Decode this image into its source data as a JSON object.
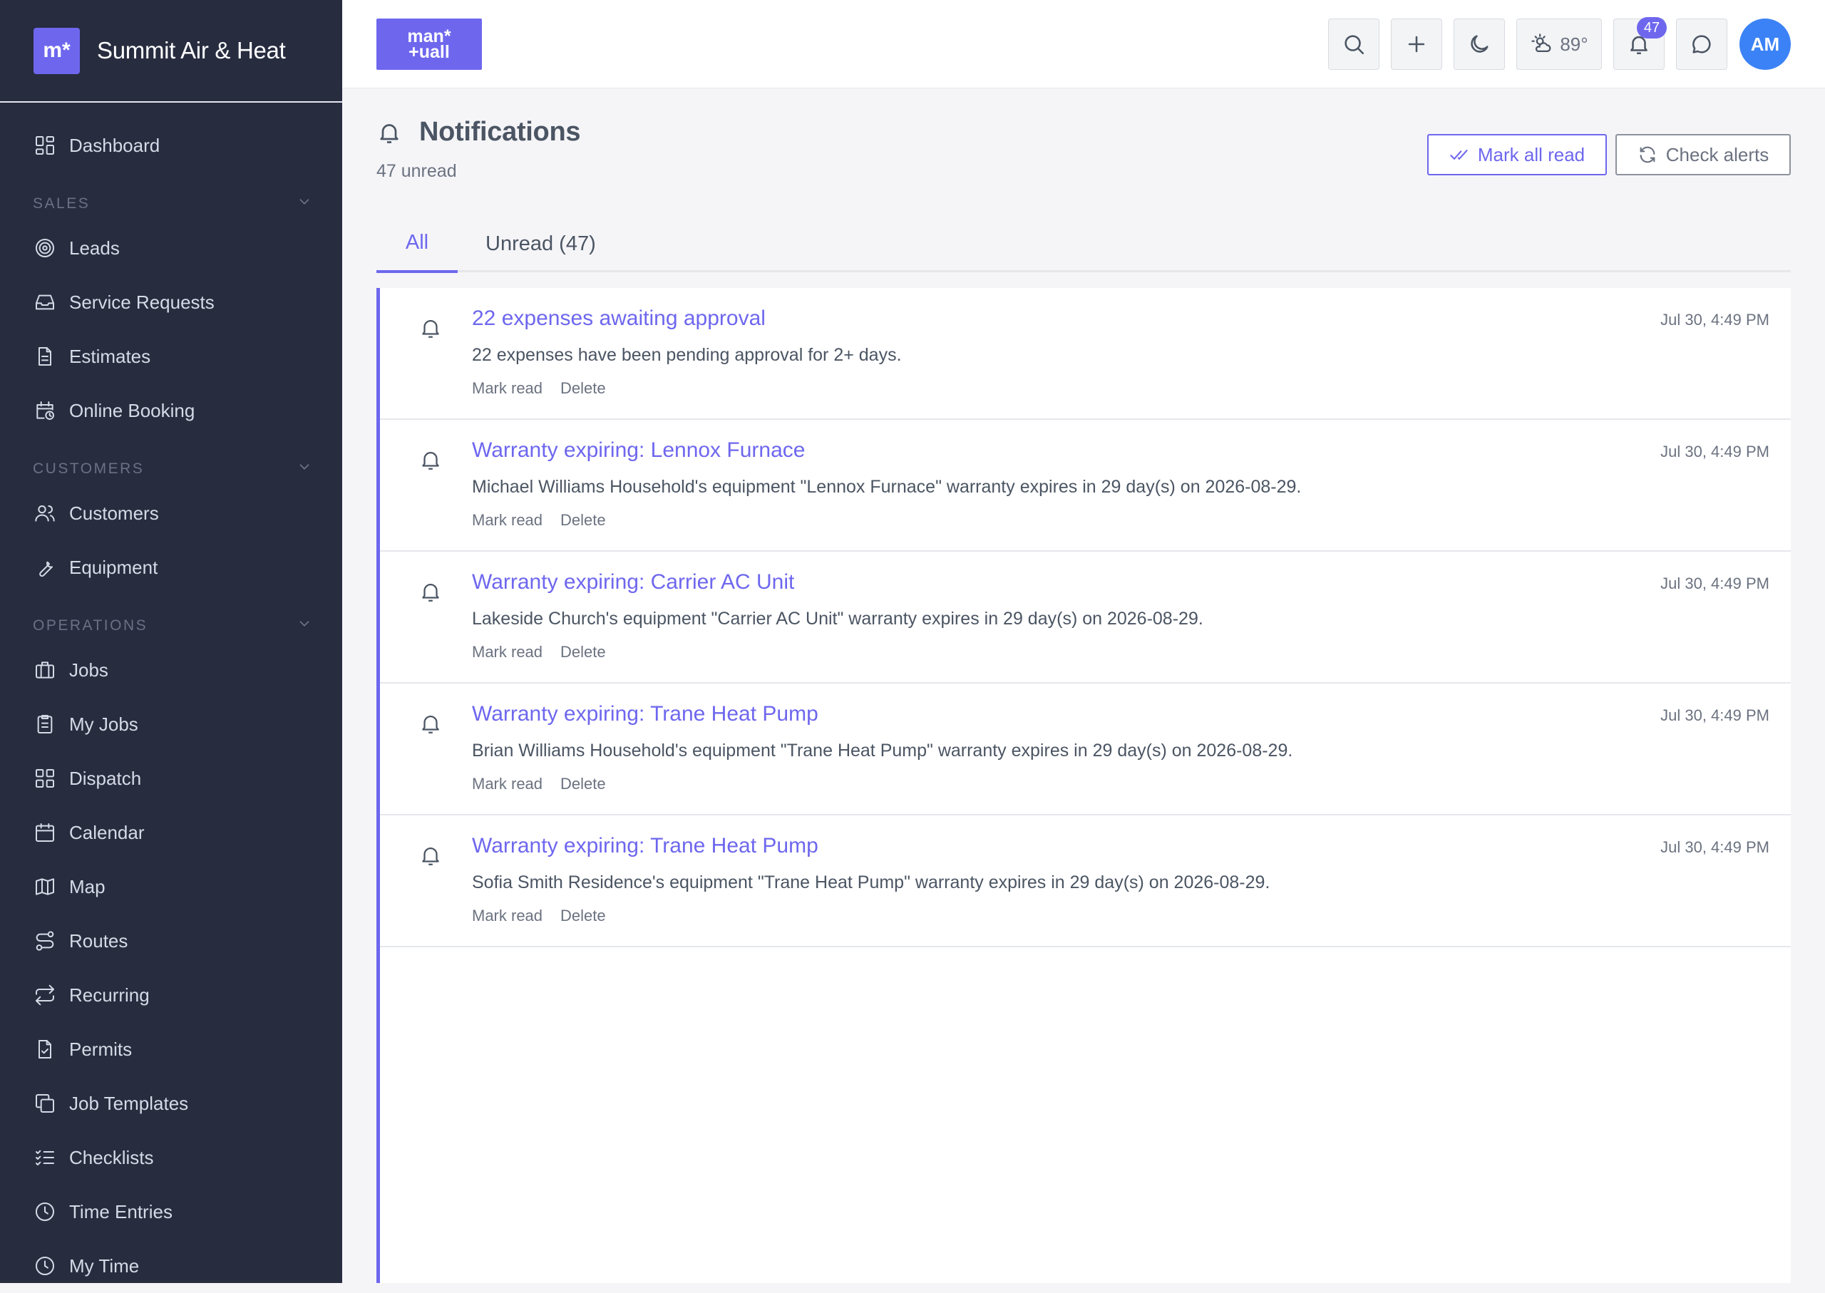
{
  "brand": {
    "logo_text": "m*",
    "name": "Summit Air & Heat"
  },
  "sidebar": {
    "items": [
      {
        "type": "item",
        "label": "Dashboard",
        "icon": "dashboard-icon"
      },
      {
        "type": "section",
        "label": "SALES"
      },
      {
        "type": "item",
        "label": "Leads",
        "icon": "target-icon"
      },
      {
        "type": "item",
        "label": "Service Requests",
        "icon": "inbox-icon"
      },
      {
        "type": "item",
        "label": "Estimates",
        "icon": "document-icon"
      },
      {
        "type": "item",
        "label": "Online Booking",
        "icon": "calendar-clock-icon"
      },
      {
        "type": "section",
        "label": "CUSTOMERS"
      },
      {
        "type": "item",
        "label": "Customers",
        "icon": "users-icon"
      },
      {
        "type": "item",
        "label": "Equipment",
        "icon": "wrench-icon"
      },
      {
        "type": "section",
        "label": "OPERATIONS"
      },
      {
        "type": "item",
        "label": "Jobs",
        "icon": "briefcase-icon"
      },
      {
        "type": "item",
        "label": "My Jobs",
        "icon": "clipboard-icon"
      },
      {
        "type": "item",
        "label": "Dispatch",
        "icon": "grid-icon"
      },
      {
        "type": "item",
        "label": "Calendar",
        "icon": "calendar-icon"
      },
      {
        "type": "item",
        "label": "Map",
        "icon": "map-icon"
      },
      {
        "type": "item",
        "label": "Routes",
        "icon": "route-icon"
      },
      {
        "type": "item",
        "label": "Recurring",
        "icon": "repeat-icon"
      },
      {
        "type": "item",
        "label": "Permits",
        "icon": "file-check-icon"
      },
      {
        "type": "item",
        "label": "Job Templates",
        "icon": "copy-icon"
      },
      {
        "type": "item",
        "label": "Checklists",
        "icon": "checklist-icon"
      },
      {
        "type": "item",
        "label": "Time Entries",
        "icon": "clock-icon"
      },
      {
        "type": "item",
        "label": "My Time",
        "icon": "clock-icon"
      }
    ]
  },
  "topbar": {
    "app_logo_line1": "man*",
    "app_logo_line2": "+uall",
    "weather": "89°",
    "notification_count": "47",
    "avatar_initials": "AM"
  },
  "page": {
    "title": "Notifications",
    "subtitle": "47 unread",
    "mark_all_read": "Mark all read",
    "check_alerts": "Check alerts",
    "tabs": [
      {
        "label": "All"
      },
      {
        "label": "Unread (47)"
      }
    ]
  },
  "notifications": [
    {
      "title": "22 expenses awaiting approval",
      "message": "22 expenses have been pending approval for 2+ days.",
      "time": "Jul 30, 4:49 PM",
      "mark_read": "Mark read",
      "delete": "Delete"
    },
    {
      "title": "Warranty expiring: Lennox Furnace",
      "message": "Michael Williams Household's equipment \"Lennox Furnace\" warranty expires in 29 day(s) on 2026-08-29.",
      "time": "Jul 30, 4:49 PM",
      "mark_read": "Mark read",
      "delete": "Delete"
    },
    {
      "title": "Warranty expiring: Carrier AC Unit",
      "message": "Lakeside Church's equipment \"Carrier AC Unit\" warranty expires in 29 day(s) on 2026-08-29.",
      "time": "Jul 30, 4:49 PM",
      "mark_read": "Mark read",
      "delete": "Delete"
    },
    {
      "title": "Warranty expiring: Trane Heat Pump",
      "message": "Brian Williams Household's equipment \"Trane Heat Pump\" warranty expires in 29 day(s) on 2026-08-29.",
      "time": "Jul 30, 4:49 PM",
      "mark_read": "Mark read",
      "delete": "Delete"
    },
    {
      "title": "Warranty expiring: Trane Heat Pump",
      "message": "Sofia Smith Residence's equipment \"Trane Heat Pump\" warranty expires in 29 day(s) on 2026-08-29.",
      "time": "Jul 30, 4:49 PM",
      "mark_read": "Mark read",
      "delete": "Delete"
    }
  ],
  "colors": {
    "sidebar_bg": "#272c3f",
    "accent": "#6e67ee",
    "avatar": "#3b82f6"
  }
}
